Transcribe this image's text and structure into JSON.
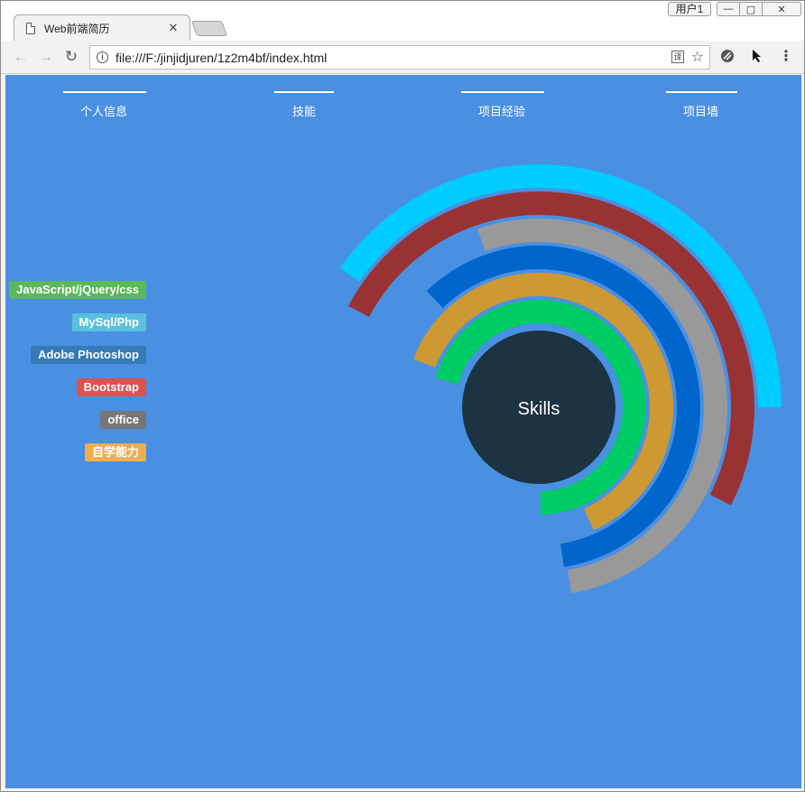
{
  "browser": {
    "tab_title": "Web前端简历",
    "url": "file:///F:/jinjidjuren/1z2m4bf/index.html",
    "user_badge": "用户1",
    "controls": {
      "back": "←",
      "forward": "→",
      "reload": "↻",
      "minimize": "—",
      "maximize": "▢",
      "close": "✕",
      "tab_close": "✕",
      "info": "i",
      "translate": "译",
      "star": "☆",
      "menu": "⋮"
    }
  },
  "page": {
    "background": "#4a90e2",
    "nav": [
      {
        "label": "个人信息"
      },
      {
        "label": "技能"
      },
      {
        "label": "项目经验"
      },
      {
        "label": "项目墙"
      }
    ],
    "skills": [
      {
        "label": "JavaScript/jQuery/css",
        "color": "#5cb85c"
      },
      {
        "label": "MySql/Php",
        "color": "#5bc0de"
      },
      {
        "label": "Adobe Photoshop",
        "color": "#337ab7"
      },
      {
        "label": "Bootstrap",
        "color": "#d9534f"
      },
      {
        "label": "office",
        "color": "#777777"
      },
      {
        "label": "自学能力",
        "color": "#f0ad4e"
      }
    ],
    "chart": {
      "center_label": "Skills",
      "center_color": "#1c3341",
      "rings": [
        {
          "color": "#00ccff"
        },
        {
          "color": "#993333"
        },
        {
          "color": "#999999"
        },
        {
          "color": "#0066cc"
        },
        {
          "color": "#cc9933"
        },
        {
          "color": "#00cc66"
        }
      ]
    }
  }
}
